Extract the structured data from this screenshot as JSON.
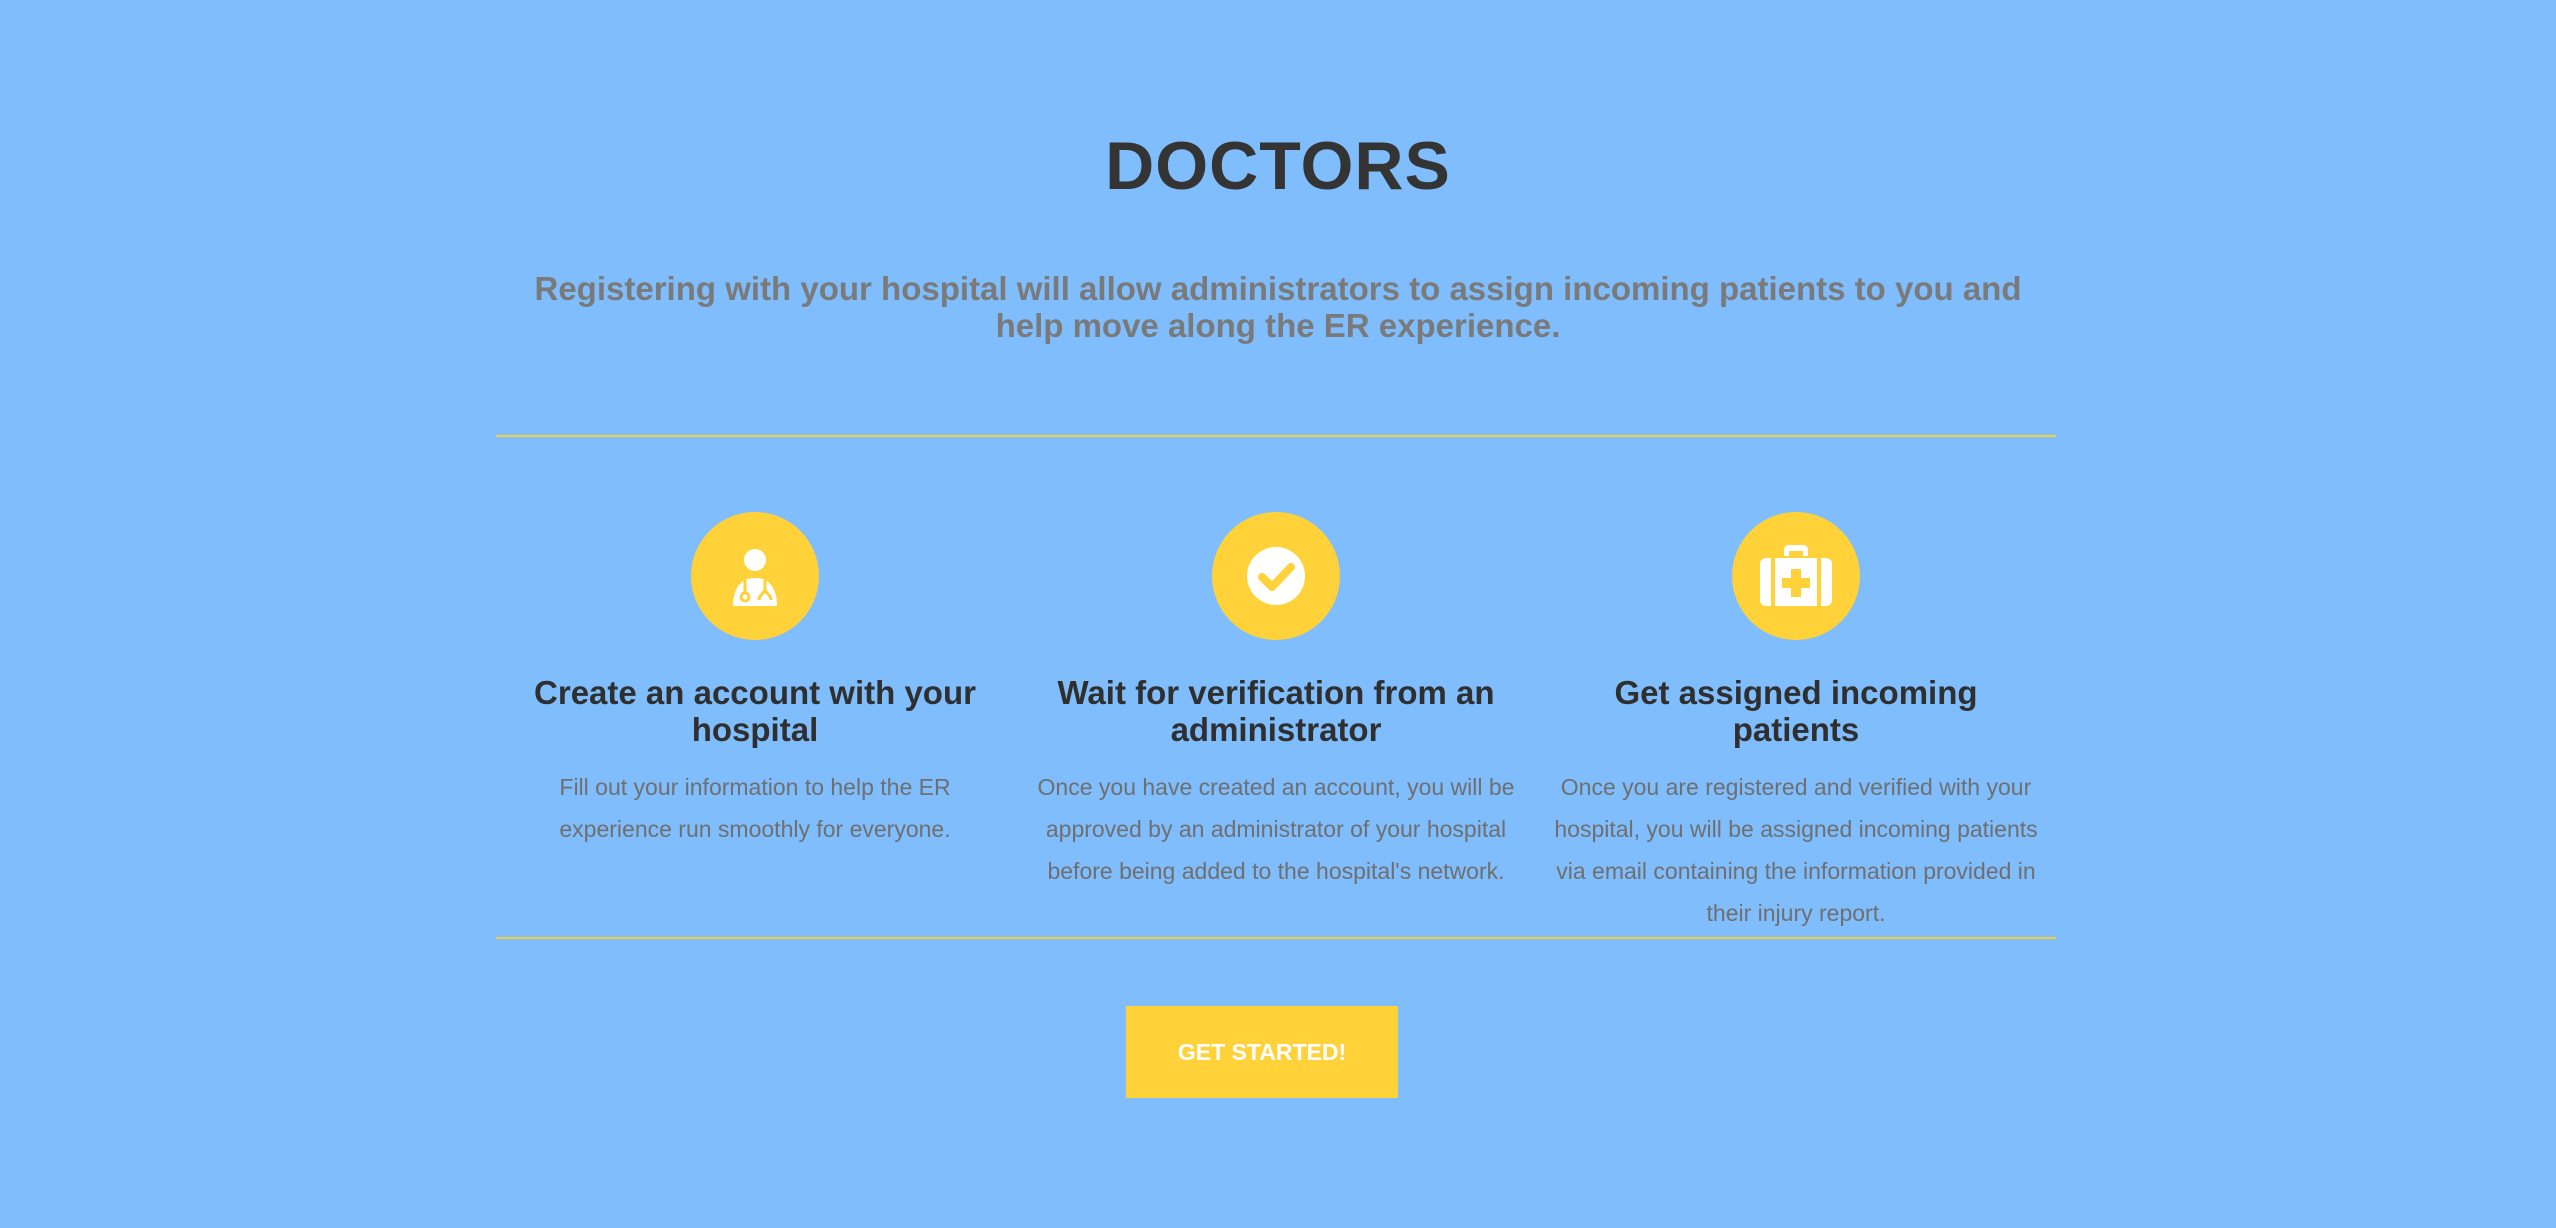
{
  "section": {
    "title": "DOCTORS",
    "subtitle": "Registering with your hospital will allow administrators to assign incoming patients to you and help move along the ER experience."
  },
  "features": [
    {
      "icon": "doctor-icon",
      "title": "Create an account with your hospital",
      "text": "Fill out your information to help the ER experience run smoothly for everyone."
    },
    {
      "icon": "check-circle-icon",
      "title": "Wait for verification from an administrator",
      "text": "Once you have created an account, you will be approved by an administrator of your hospital before being added to the hospital's network."
    },
    {
      "icon": "medical-kit-icon",
      "title": "Get assigned incoming patients",
      "text": "Once you are registered and verified with your hospital, you will be assigned incoming patients via email containing the information provided in their injury report."
    }
  ],
  "cta": {
    "label": "GET STARTED!"
  },
  "colors": {
    "background": "#7fbdfd",
    "accent": "#ffd23a",
    "rule": "#f0cf3a",
    "heading": "#343434",
    "muted": "#7a7a7a"
  }
}
